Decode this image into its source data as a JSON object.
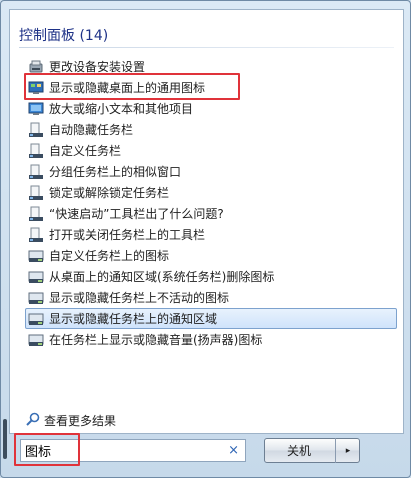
{
  "header": {
    "title": "控制面板 (14)"
  },
  "items": [
    {
      "label": "更改设备安装设置",
      "icon": "device-install-icon"
    },
    {
      "label": "显示或隐藏桌面上的通用图标",
      "icon": "desktop-icon"
    },
    {
      "label": "放大或缩小文本和其他项目",
      "icon": "display-icon"
    },
    {
      "label": "自动隐藏任务栏",
      "icon": "taskbar-icon"
    },
    {
      "label": "自定义任务栏",
      "icon": "taskbar-icon"
    },
    {
      "label": "分组任务栏上的相似窗口",
      "icon": "taskbar-icon"
    },
    {
      "label": "锁定或解除锁定任务栏",
      "icon": "taskbar-icon"
    },
    {
      "label": "“快速启动”工具栏出了什么问题?",
      "icon": "taskbar-icon"
    },
    {
      "label": "打开或关闭任务栏上的工具栏",
      "icon": "taskbar-icon"
    },
    {
      "label": "自定义任务栏上的图标",
      "icon": "notification-area-icon"
    },
    {
      "label": "从桌面上的通知区域(系统任务栏)删除图标",
      "icon": "notification-area-icon"
    },
    {
      "label": "显示或隐藏任务栏上不活动的图标",
      "icon": "notification-area-icon"
    },
    {
      "label": "显示或隐藏任务栏上的通知区域",
      "icon": "notification-area-icon"
    },
    {
      "label": "在任务栏上显示或隐藏音量(扬声器)图标",
      "icon": "notification-area-icon"
    }
  ],
  "selected_index": 12,
  "highlighted_index": 1,
  "more_results": {
    "label": "查看更多结果",
    "icon": "magnifier-icon"
  },
  "search": {
    "value": "图标",
    "clear": "×"
  },
  "shutdown": {
    "label": "关机",
    "arrow": "▸"
  },
  "colors": {
    "accent": "#1e3287",
    "highlight": "#e0333a",
    "selection": "#cfe3fb"
  }
}
